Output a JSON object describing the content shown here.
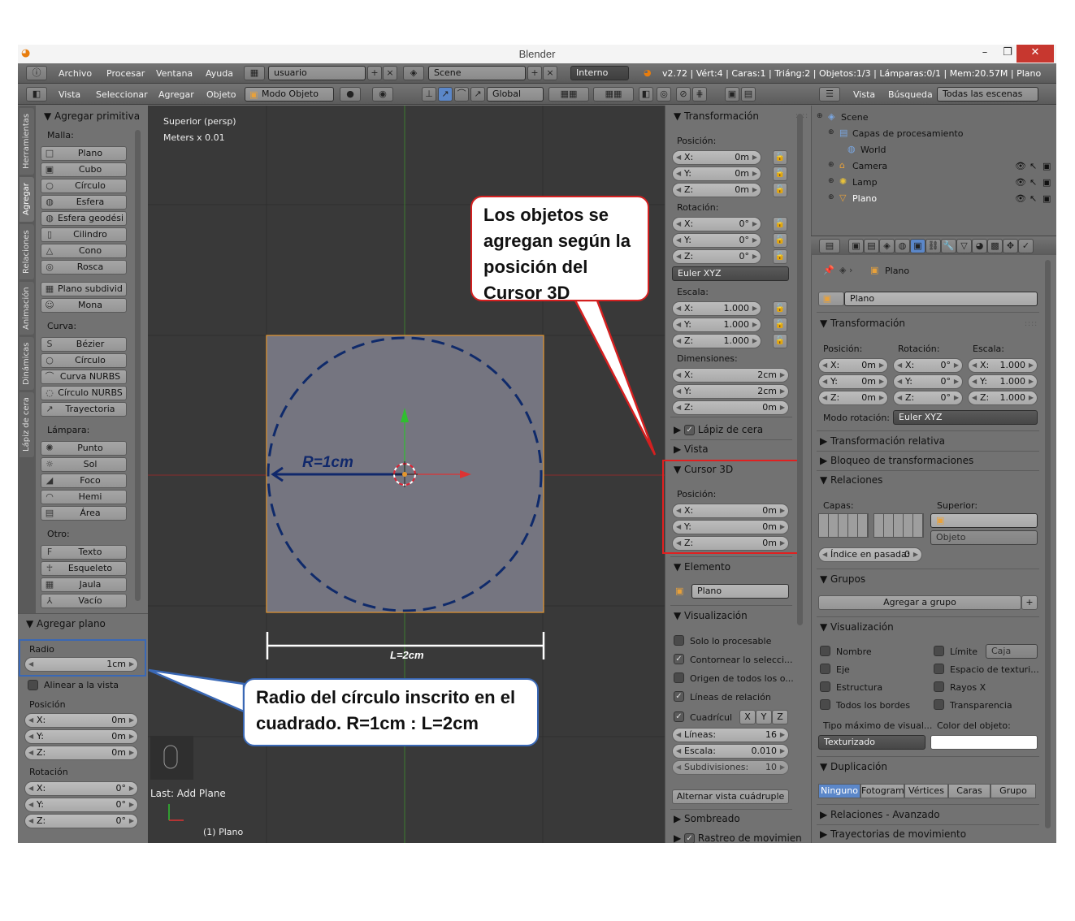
{
  "window": {
    "title": "Blender",
    "minimize": "–",
    "restore": "❐",
    "close": "✕"
  },
  "info_header": {
    "menus": [
      "Archivo",
      "Procesar",
      "Ventana",
      "Ayuda"
    ],
    "screen": "usuario",
    "scene": "Scene",
    "engine": "Interno",
    "stats": "v2.72 | Vért:4 | Caras:1 | Triáng:2 | Objetos:1/3 | Lámparas:0/1 | Mem:20.57M | Plano"
  },
  "view_header": {
    "menus": [
      "Vista",
      "Seleccionar",
      "Agregar",
      "Objeto"
    ],
    "mode": "Modo Objeto",
    "orientation": "Global"
  },
  "tool_tabs": [
    "Herramientas",
    "Agregar",
    "Relaciones",
    "Animación",
    "Dinámicas",
    "Lápiz de cera"
  ],
  "toolshelf": {
    "panel_title": "Agregar primitiva",
    "groups": [
      {
        "label": "Malla:",
        "items": [
          {
            "icon": "□",
            "label": "Plano"
          },
          {
            "icon": "▣",
            "label": "Cubo"
          },
          {
            "icon": "○",
            "label": "Círculo"
          },
          {
            "icon": "◍",
            "label": "Esfera"
          },
          {
            "icon": "◍",
            "label": "Esfera geodésica"
          },
          {
            "icon": "▯",
            "label": "Cilindro"
          },
          {
            "icon": "△",
            "label": "Cono"
          },
          {
            "icon": "◎",
            "label": "Rosca"
          },
          {
            "icon": "▦",
            "label": "Plano subdividi..."
          },
          {
            "icon": "☺",
            "label": "Mona"
          }
        ]
      },
      {
        "label": "Curva:",
        "items": [
          {
            "icon": "S",
            "label": "Bézier"
          },
          {
            "icon": "○",
            "label": "Círculo"
          },
          {
            "icon": "⌒",
            "label": "Curva NURBS"
          },
          {
            "icon": "◌",
            "label": "Círculo NURBS"
          },
          {
            "icon": "↗",
            "label": "Trayectoria"
          }
        ]
      },
      {
        "label": "Lámpara:",
        "items": [
          {
            "icon": "✺",
            "label": "Punto"
          },
          {
            "icon": "☼",
            "label": "Sol"
          },
          {
            "icon": "◢",
            "label": "Foco"
          },
          {
            "icon": "◠",
            "label": "Hemi"
          },
          {
            "icon": "▤",
            "label": "Área"
          }
        ]
      },
      {
        "label": "Otro:",
        "items": [
          {
            "icon": "F",
            "label": "Texto"
          },
          {
            "icon": "☥",
            "label": "Esqueleto"
          },
          {
            "icon": "▦",
            "label": "Jaula"
          },
          {
            "icon": "⅄",
            "label": "Vacío"
          }
        ]
      }
    ]
  },
  "operator_panel": {
    "title": "Agregar plano",
    "radio_label": "Radio",
    "radio_value": "1cm",
    "align_label": "Alinear a la vista",
    "position_label": "Posición",
    "position": [
      {
        "k": "X:",
        "v": "0m"
      },
      {
        "k": "Y:",
        "v": "0m"
      },
      {
        "k": "Z:",
        "v": "0m"
      }
    ],
    "rotation_label": "Rotación",
    "rotation": [
      {
        "k": "X:",
        "v": "0°"
      },
      {
        "k": "Y:",
        "v": "0°"
      },
      {
        "k": "Z:",
        "v": "0°"
      }
    ]
  },
  "viewport": {
    "view_name": "Superior (persp)",
    "units": "Meters x 0.01",
    "radius_label": "R=1cm",
    "length_label": "L=2cm",
    "last_op": "Last: Add Plane",
    "object_label": "(1) Plano"
  },
  "properties_n": {
    "transform_title": "Transformación",
    "position_label": "Posición:",
    "position": [
      {
        "k": "X:",
        "v": "0m"
      },
      {
        "k": "Y:",
        "v": "0m"
      },
      {
        "k": "Z:",
        "v": "0m"
      }
    ],
    "rotation_label": "Rotación:",
    "rotation": [
      {
        "k": "X:",
        "v": "0°"
      },
      {
        "k": "Y:",
        "v": "0°"
      },
      {
        "k": "Z:",
        "v": "0°"
      }
    ],
    "rotation_mode": "Euler XYZ",
    "scale_label": "Escala:",
    "scale": [
      {
        "k": "X:",
        "v": "1.000"
      },
      {
        "k": "Y:",
        "v": "1.000"
      },
      {
        "k": "Z:",
        "v": "1.000"
      }
    ],
    "dimensions_label": "Dimensiones:",
    "dimensions": [
      {
        "k": "X:",
        "v": "2cm"
      },
      {
        "k": "Y:",
        "v": "2cm"
      },
      {
        "k": "Z:",
        "v": "0m"
      }
    ],
    "grease_pencil": "Lápiz de cera",
    "view": "Vista",
    "cursor_title": "Cursor 3D",
    "cursor_position_label": "Posición:",
    "cursor": [
      {
        "k": "X:",
        "v": "0m"
      },
      {
        "k": "Y:",
        "v": "0m"
      },
      {
        "k": "Z:",
        "v": "0m"
      }
    ],
    "item_title": "Elemento",
    "item_name": "Plano",
    "display_title": "Visualización",
    "display_checks": [
      "Solo lo procesable",
      "Contornear lo selecci...",
      "Origen de todos los o...",
      "Líneas de relación"
    ],
    "grid_floor": "Cuadrícul",
    "axes": [
      "X",
      "Y",
      "Z"
    ],
    "lines_k": "Líneas:",
    "lines_v": "16",
    "scale_k": "Escala:",
    "scale_v": "0.010",
    "subdiv_k": "Subdivisiones:",
    "subdiv_v": "10",
    "quad_view": "Alternar vista cuádruple",
    "shading": "Sombreado",
    "motion_tracking": "Rastreo de movimien"
  },
  "outliner": {
    "menus": [
      "Vista",
      "Búsqueda"
    ],
    "filter": "Todas las escenas",
    "items": [
      "Scene",
      "Capas de procesamiento",
      "World",
      "Camera",
      "Lamp",
      "Plano"
    ]
  },
  "object_props": {
    "breadcrumb": "Plano",
    "name": "Plano",
    "transform_title": "Transformación",
    "cols": [
      "Posición:",
      "Rotación:",
      "Escala:"
    ],
    "pos": [
      "0m",
      "0m",
      "0m"
    ],
    "rot": [
      "0°",
      "0°",
      "0°"
    ],
    "scl": [
      "1.000",
      "1.000",
      "1.000"
    ],
    "axes": [
      "X:",
      "Y:",
      "Z:"
    ],
    "rot_mode_label": "Modo rotación:",
    "rot_mode": "Euler XYZ",
    "delta": "Transformación relativa",
    "locks": "Bloqueo de transformaciones",
    "relations": "Relaciones",
    "layers_label": "Capas:",
    "parent_label": "Superior:",
    "parent_type": "Objeto",
    "pass_index": "Índice en pasada:",
    "pass_index_value": "0",
    "groups": "Grupos",
    "add_group": "Agregar a grupo",
    "display": "Visualización",
    "disp_left": [
      "Nombre",
      "Eje",
      "Estructura",
      "Todos los bordes"
    ],
    "disp_right": [
      "Límite",
      "Espacio de texturi...",
      "Rayos X",
      "Transparencia"
    ],
    "bounds_type": "Caja",
    "max_draw_label": "Tipo máximo de visual...",
    "max_draw": "Texturizado",
    "obj_color_label": "Color del objeto:",
    "duplication": "Duplicación",
    "dup_modes": [
      "Ninguno",
      "Fotogram",
      "Vértices",
      "Caras",
      "Grupo"
    ],
    "rel_extras": "Relaciones - Avanzado",
    "motion_paths": "Trayectorias de movimiento"
  },
  "callouts": {
    "top": "Los objetos se agregan según la posición del Cursor 3D",
    "bottom": "Radio del círculo inscrito en el cuadrado. R=1cm : L=2cm"
  }
}
